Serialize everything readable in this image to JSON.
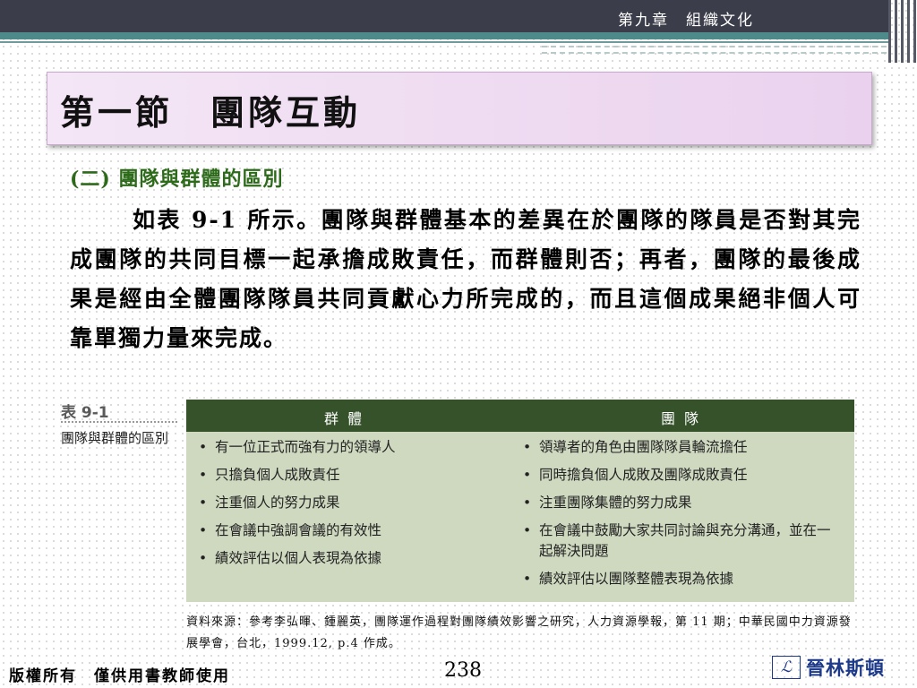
{
  "header": {
    "chapter": "第九章　組織文化"
  },
  "title": "第一節　團隊互動",
  "subheading": "(二) 團隊與群體的區別",
  "paragraph": "如表 9-1 所示。團隊與群體基本的差異在於團隊的隊員是否對其完成團隊的共同目標一起承擔成敗責任，而群體則否；再者，團隊的最後成果是經由全體團隊隊員共同貢獻心力所完成的，而且這個成果絕非個人可靠單獨力量來完成。",
  "figure": {
    "label": "表 9-1",
    "caption": "團隊與群體的區別",
    "columns": [
      {
        "header": "群體",
        "items": [
          "有一位正式而強有力的領導人",
          "只擔負個人成敗責任",
          "注重個人的努力成果",
          "在會議中強調會議的有效性",
          "績效評估以個人表現為依據"
        ]
      },
      {
        "header": "團隊",
        "items": [
          "領導者的角色由團隊隊員輪流擔任",
          "同時擔負個人成敗及團隊成敗責任",
          "注重團隊集體的努力成果",
          "在會議中鼓勵大家共同討論與充分溝通，並在一起解決問題",
          "績效評估以團隊整體表現為依據"
        ]
      }
    ],
    "source": "資料來源：參考李弘暉、鍾麗英，團隊運作過程對團隊績效影響之研究，人力資源學報，第 11 期；中華民國中力資源發展學會，台北，1999.12, p.4 作成。"
  },
  "footer": {
    "copyright": "版權所有　僅供用書教師使用",
    "page_number": "238",
    "publisher": "晉林斯頓",
    "logo_mark": "ℒ"
  },
  "colors": {
    "header_dark": "#3b3d4a",
    "header_teal": "#4f8a8b",
    "subheading_green": "#2d6b1b",
    "table_header": "#35522b",
    "table_body": "#cfd9c0",
    "publisher_blue": "#1d3a8a"
  }
}
